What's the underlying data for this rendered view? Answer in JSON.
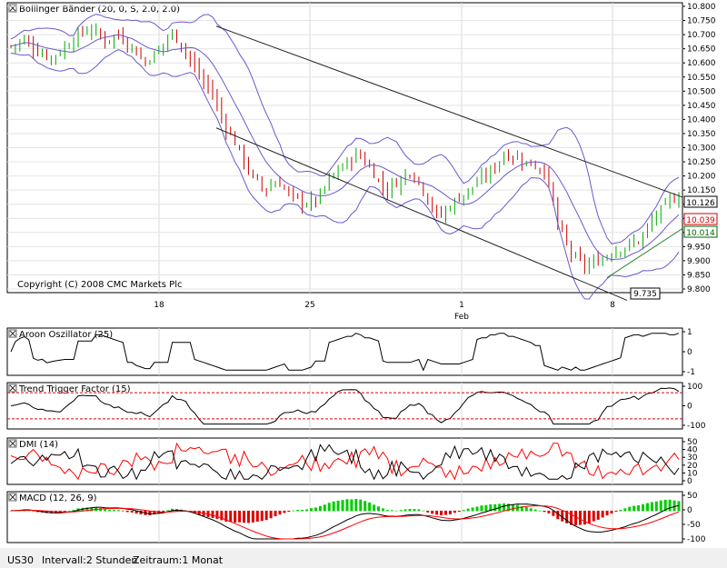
{
  "symbol": "US30",
  "interval_label": "Intervall:2 Stunden",
  "period_label": "Zeitraum:1 Monat",
  "copyright": "Copyright (C) 2008 CMC Markets Plc",
  "x_axis": {
    "ticks": [
      "18",
      "25",
      "1",
      "8"
    ],
    "month_label": "Feb"
  },
  "chart_data": [
    {
      "type": "ohlc",
      "title": "Bollinger Bänder (20, 0, S, 2.0, 2.0)",
      "ylim": [
        9.8,
        10.8
      ],
      "yticks": [
        "10.800",
        "10.750",
        "10.700",
        "10.650",
        "10.600",
        "10.550",
        "10.500",
        "10.450",
        "10.400",
        "10.350",
        "10.300",
        "10.250",
        "10.200",
        "10.150",
        "10.100",
        "10.050",
        "10.000",
        "9.950",
        "9.900",
        "9.850",
        "9.800"
      ],
      "price_labels": [
        {
          "value": "10.126",
          "color": "#000000"
        },
        {
          "value": "10.039",
          "color": "#cc0000"
        },
        {
          "value": "10.014",
          "color": "#006600"
        }
      ],
      "low_marker": "9.735",
      "grid": true,
      "close_approx": [
        10.66,
        10.68,
        10.64,
        10.62,
        10.65,
        10.7,
        10.72,
        10.68,
        10.7,
        10.66,
        10.6,
        10.64,
        10.71,
        10.65,
        10.56,
        10.5,
        10.38,
        10.3,
        10.2,
        10.15,
        10.18,
        10.13,
        10.1,
        10.12,
        10.2,
        10.24,
        10.28,
        10.22,
        10.15,
        10.18,
        10.22,
        10.14,
        10.05,
        10.1,
        10.14,
        10.18,
        10.22,
        10.28,
        10.26,
        10.24,
        10.22,
        10.02,
        9.92,
        9.88,
        9.9,
        9.93,
        9.95,
        9.97,
        10.04,
        10.1,
        10.13
      ]
    },
    {
      "type": "line",
      "title": "Aroon Oszillator (25)",
      "yticks": [
        "1",
        "0",
        "-1"
      ]
    },
    {
      "type": "line",
      "title": "Trend Trigger Factor (15)",
      "yticks": [
        "100",
        "0",
        "-100"
      ],
      "reference_levels": [
        100,
        -100
      ]
    },
    {
      "type": "line",
      "title": "DMI (14)",
      "yticks": [
        "50",
        "40",
        "30",
        "20",
        "10",
        "0"
      ],
      "series_colors": [
        "#000000",
        "#ff0000"
      ]
    },
    {
      "type": "line",
      "title": "MACD (12, 26, 9)",
      "yticks": [
        "50",
        "0",
        "-50",
        "-100"
      ],
      "series_colors": [
        "#000000",
        "#ff0000"
      ]
    }
  ]
}
